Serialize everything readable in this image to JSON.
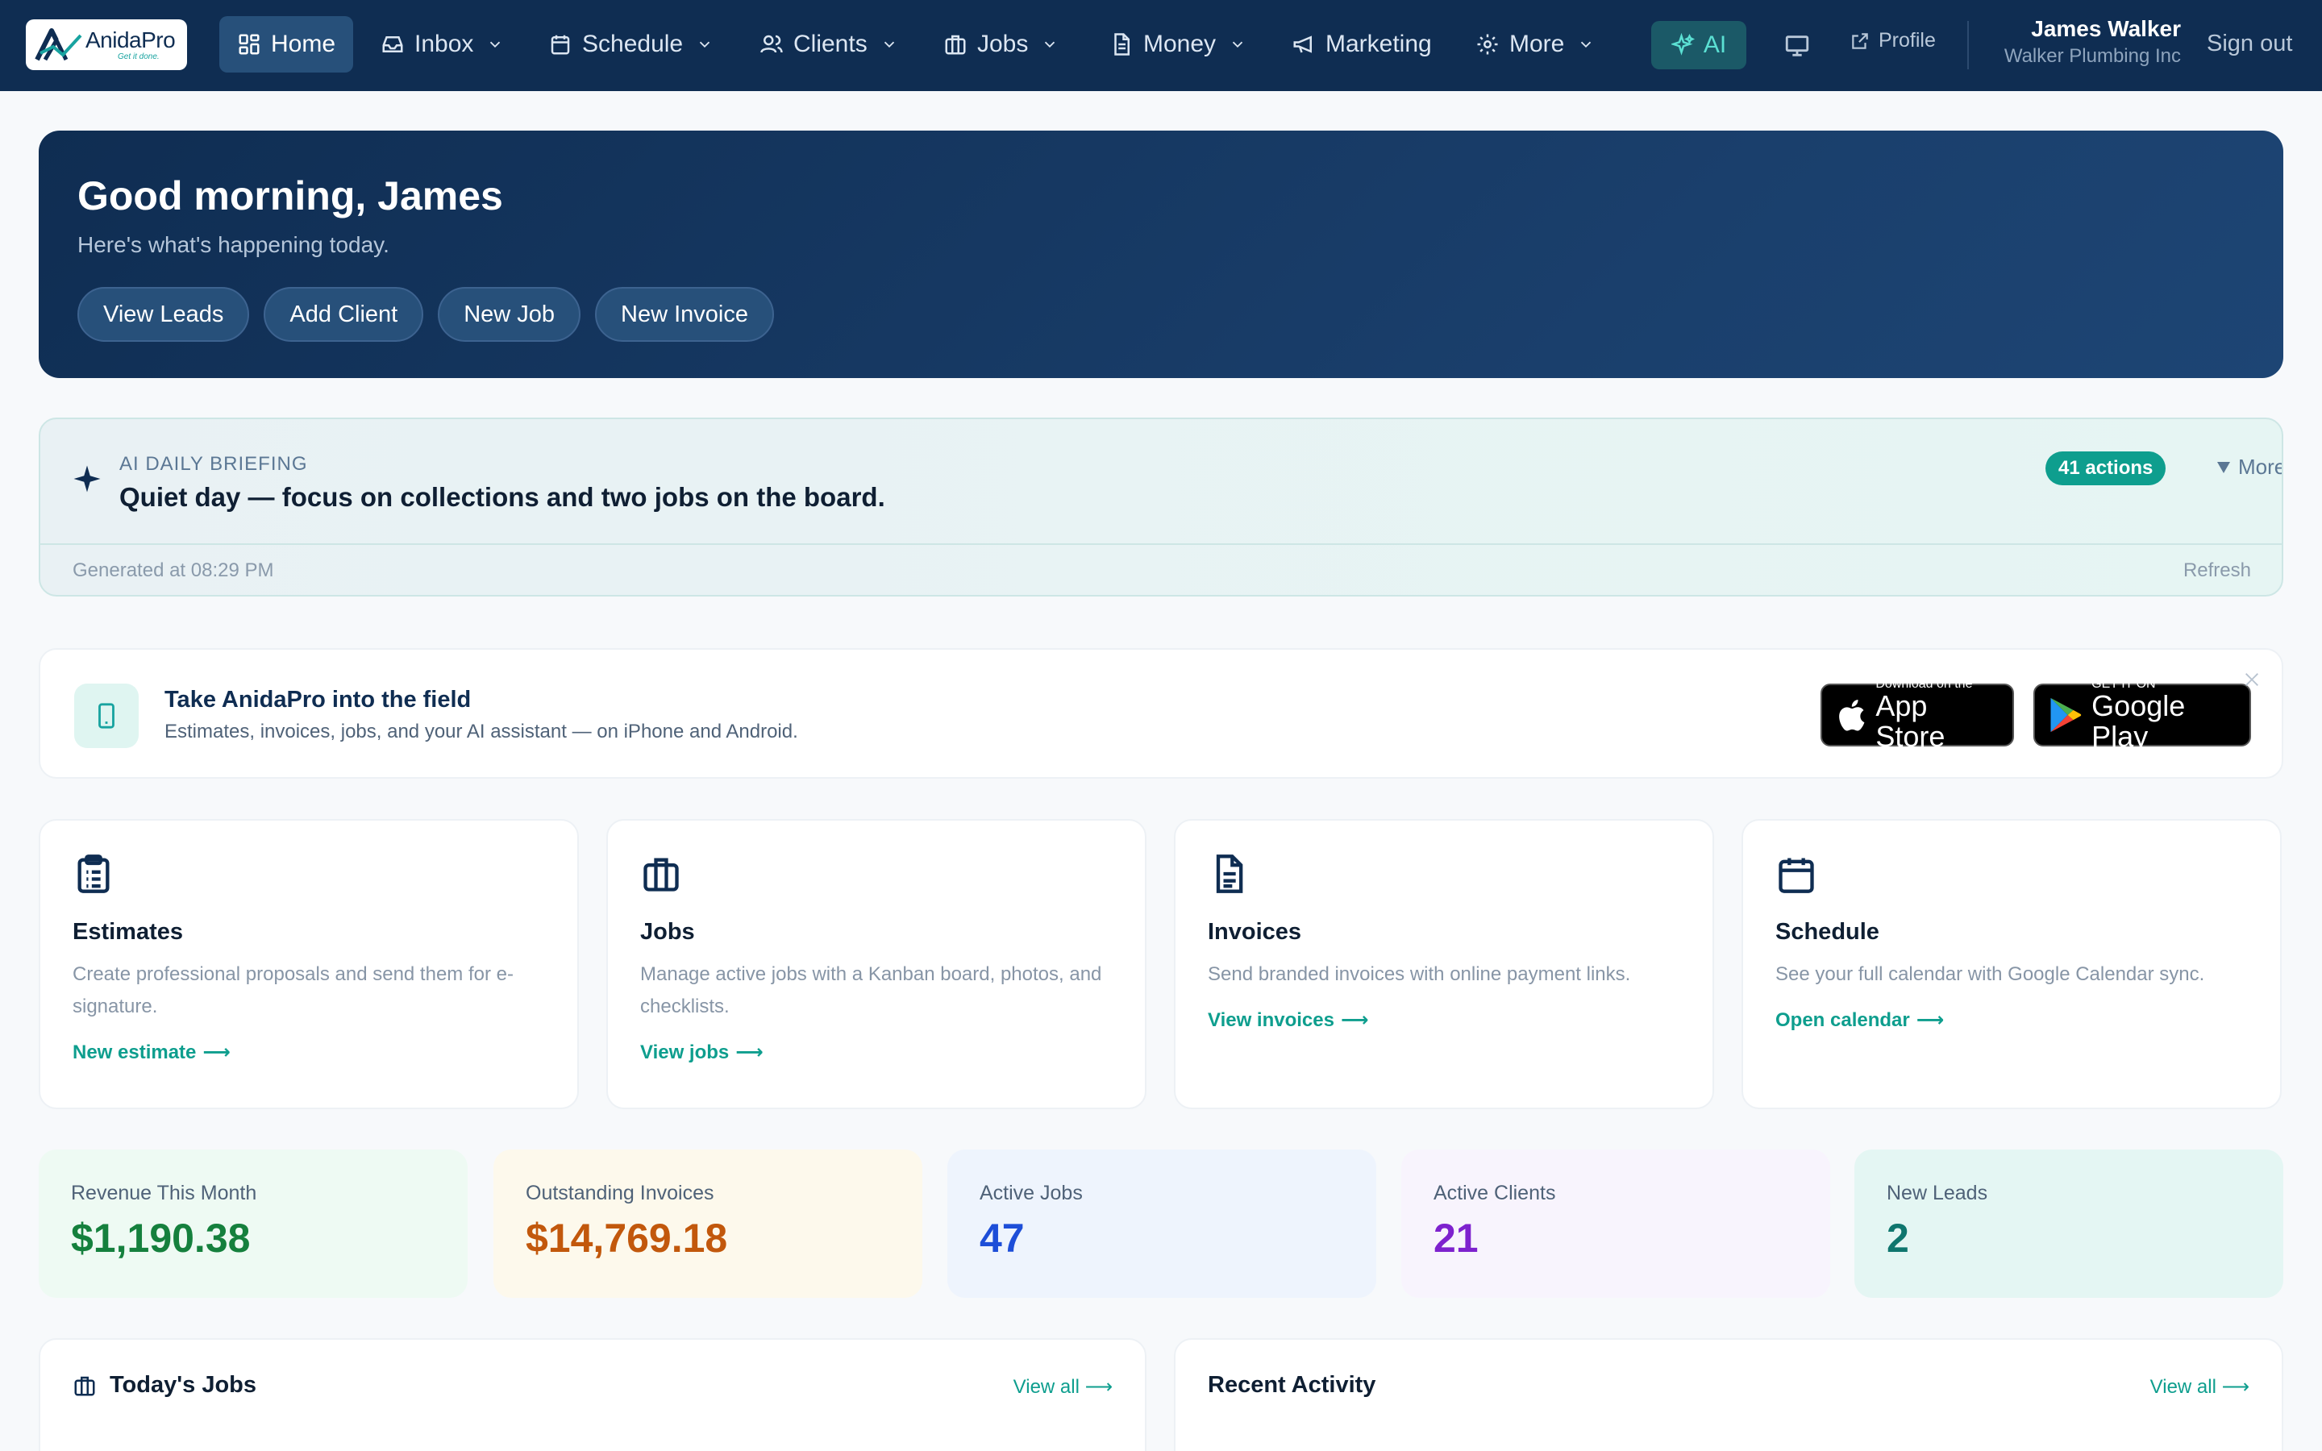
{
  "nav": {
    "brand_name": "AnidaPro",
    "brand_tagline": "Get it done.",
    "items": [
      {
        "label": "Home"
      },
      {
        "label": "Inbox"
      },
      {
        "label": "Schedule"
      },
      {
        "label": "Clients"
      },
      {
        "label": "Jobs"
      },
      {
        "label": "Money"
      },
      {
        "label": "Marketing"
      },
      {
        "label": "More"
      }
    ],
    "ai_label": "AI",
    "profile_label": "Profile",
    "user_name": "James Walker",
    "user_company": "Walker Plumbing Inc",
    "signout_label": "Sign out"
  },
  "hero": {
    "greeting": "Good morning, James",
    "subtitle": "Here's what's happening today.",
    "actions": [
      "View Leads",
      "Add Client",
      "New Job",
      "New Invoice"
    ]
  },
  "briefing": {
    "kicker": "AI DAILY BRIEFING",
    "headline": "Quiet day — focus on collections and two jobs on the board.",
    "actions_badge": "41 actions",
    "more_label": "More",
    "generated": "Generated at 08:29 PM",
    "refresh_label": "Refresh"
  },
  "promo": {
    "title": "Take AnidaPro into the field",
    "subtitle": "Estimates, invoices, jobs, and your AI assistant — on iPhone and Android.",
    "appstore_small": "Download on the",
    "appstore_big": "App Store",
    "googleplay_small": "GET IT ON",
    "googleplay_big": "Google Play"
  },
  "features": [
    {
      "title": "Estimates",
      "desc": "Create professional proposals and send them for e-signature.",
      "link": "New estimate",
      "icon": "clipboard-list-icon"
    },
    {
      "title": "Jobs",
      "desc": "Manage active jobs with a Kanban board, photos, and checklists.",
      "link": "View jobs",
      "icon": "briefcase-icon"
    },
    {
      "title": "Invoices",
      "desc": "Send branded invoices with online payment links.",
      "link": "View invoices",
      "icon": "file-text-icon"
    },
    {
      "title": "Schedule",
      "desc": "See your full calendar with Google Calendar sync.",
      "link": "Open calendar",
      "icon": "calendar-icon"
    }
  ],
  "stats": [
    {
      "label": "Revenue This Month",
      "value": "$1,190.38",
      "color": "#15803d",
      "bg": "#eefaf3"
    },
    {
      "label": "Outstanding Invoices",
      "value": "$14,769.18",
      "color": "#c2580c",
      "bg": "#fdf9ec"
    },
    {
      "label": "Active Jobs",
      "value": "47",
      "color": "#1d4ed8",
      "bg": "#eef4fd"
    },
    {
      "label": "Active Clients",
      "value": "21",
      "color": "#7e22ce",
      "bg": "#f8f4fd"
    },
    {
      "label": "New Leads",
      "value": "2",
      "color": "#0f766e",
      "bg": "#e4f6f3"
    }
  ],
  "panels": {
    "todays_jobs_title": "Today's Jobs",
    "recent_activity_title": "Recent Activity",
    "view_all_label": "View all"
  },
  "colors": {
    "nav_bg": "#0f2d52",
    "accent": "#0e9e8e",
    "hero_bg": "#0f2d52"
  }
}
